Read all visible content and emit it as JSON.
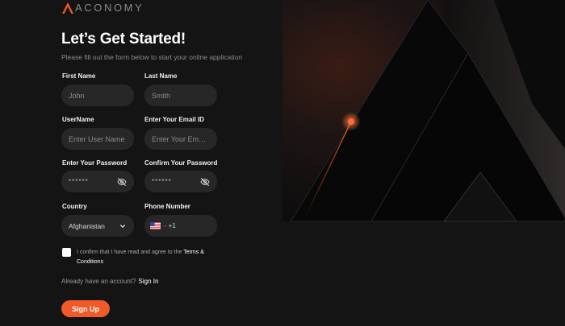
{
  "brand": {
    "name": "ACONOMY",
    "accent": "#f05a28"
  },
  "form": {
    "title": "Let’s Get Started!",
    "subtitle": "Please fill out the form below to start your online application",
    "first_name": {
      "label": "First Name",
      "value": "John"
    },
    "last_name": {
      "label": "Last Name",
      "value": "Smith"
    },
    "username": {
      "label": "UserName",
      "placeholder": "Enter User Name"
    },
    "email": {
      "label": "Enter Your Email ID",
      "placeholder": "Enter Your Email.."
    },
    "password": {
      "label": "Enter Your Password",
      "masked": "******"
    },
    "confirm_password": {
      "label": "Confirm Your Password",
      "masked": "******"
    },
    "country": {
      "label": "Country",
      "selected": "Afghanistan"
    },
    "phone": {
      "label": "Phone Number",
      "separator": "-",
      "code": "+1"
    },
    "terms": {
      "text": "I confirm that I have read and agree to the",
      "link": "Terms & Conditions",
      "checked": false
    },
    "signin": {
      "prompt": "Already have an account?",
      "link": "Sign In"
    },
    "submit_label": "Sign Up"
  },
  "icons": {
    "logo": "aconomy-logo-icon",
    "eye": "eye-off-icon",
    "dropdown": "chevron-down-icon",
    "flag": "us-flag-icon"
  }
}
